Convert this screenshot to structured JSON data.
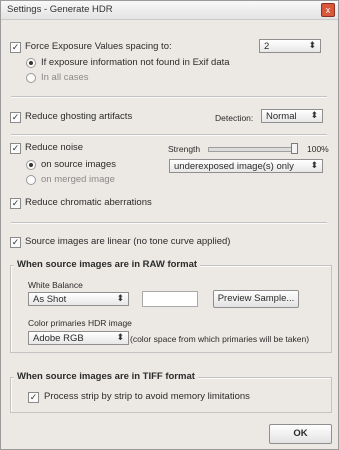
{
  "window": {
    "title": "Settings - Generate HDR"
  },
  "exposure": {
    "force_label": "Force Exposure Values spacing to:",
    "spacing_value": "2",
    "option_if_not_found": "If exposure information not found in Exif data",
    "option_all_cases": "In all cases"
  },
  "ghosting": {
    "label": "Reduce ghosting artifacts",
    "detection_label": "Detection:",
    "detection_value": "Normal"
  },
  "noise": {
    "label": "Reduce noise",
    "on_source": "on source images",
    "on_merged": "on merged image",
    "strength_label": "Strength",
    "strength_value": "100%",
    "strength_fraction": 1.0,
    "target_value": "underexposed image(s) only"
  },
  "chromatic": {
    "label": "Reduce chromatic aberrations"
  },
  "linear": {
    "label": "Source images are linear (no tone curve applied)"
  },
  "raw": {
    "legend": "When source images are in RAW format",
    "white_balance_label": "White Balance",
    "white_balance_value": "As Shot",
    "preview_button": "Preview Sample...",
    "color_primaries_label": "Color primaries HDR image",
    "color_primaries_value": "Adobe RGB",
    "color_primaries_note": "(color space from which primaries will be taken)"
  },
  "tiff": {
    "legend": "When source images are in TIFF format",
    "strip_label": "Process strip by strip to avoid memory limitations"
  },
  "footer": {
    "ok_label": "OK"
  },
  "icons": {
    "check": "✓",
    "dropdown": "⬍",
    "close": "x"
  }
}
